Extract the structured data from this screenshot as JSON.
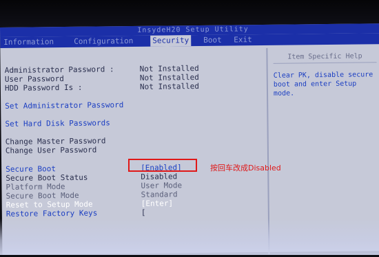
{
  "bios": {
    "title": "InsydeH20 Setup Utility",
    "tabs": [
      {
        "label": "Information"
      },
      {
        "label": "Configuration"
      },
      {
        "label": "Security"
      },
      {
        "label": "Boot"
      },
      {
        "label": "Exit"
      }
    ],
    "active_tab": "Security"
  },
  "passwords": [
    {
      "label": "Administrator Password :",
      "value": "Not Installed"
    },
    {
      "label": "User Password",
      "value": "Not Installed"
    },
    {
      "label": "HDD Password Is :",
      "value": "Not Installed"
    }
  ],
  "actions": {
    "set_admin": "Set Administrator Password",
    "set_hdd": "Set Hard Disk Passwords",
    "change_master": "Change Master Password",
    "change_user": "Change User Password"
  },
  "secure_boot": {
    "label": "Secure Boot",
    "value": "[Enabled]"
  },
  "status_rows": [
    {
      "label": "Secure Boot Status",
      "value": "Disabled"
    },
    {
      "label": "Platform Mode",
      "value": "User Mode"
    },
    {
      "label": "Secure Boot Mode",
      "value": "Standard"
    },
    {
      "label": "Reset to Setup Mode",
      "value": "[Enter]"
    },
    {
      "label": "Restore Factory Keys",
      "value": "["
    }
  ],
  "help": {
    "title": "Item Specific Help",
    "text": "Clear PK, disable secure\nboot and enter Setup\nmode."
  },
  "annotation": "按回车改成Disabled",
  "annotation_color": "#e01818"
}
